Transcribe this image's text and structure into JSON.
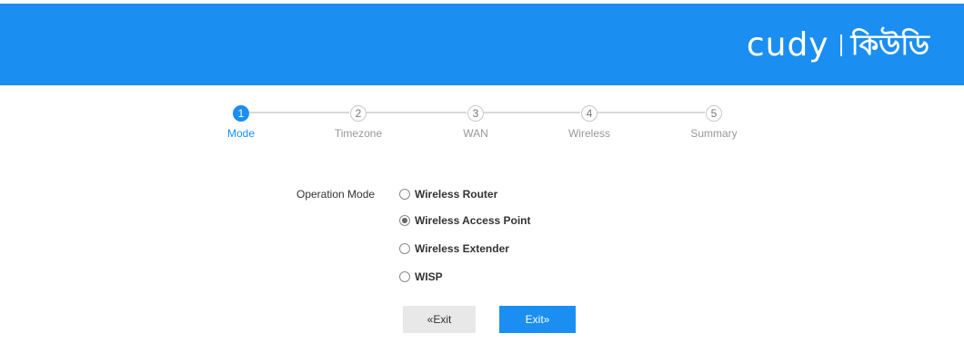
{
  "header": {
    "logo_en": "cudy",
    "logo_bn": "কিউডি",
    "color": "#1b8ef2"
  },
  "stepper": {
    "steps": [
      {
        "number": "1",
        "label": "Mode",
        "active": true
      },
      {
        "number": "2",
        "label": "Timezone",
        "active": false
      },
      {
        "number": "3",
        "label": "WAN",
        "active": false
      },
      {
        "number": "4",
        "label": "Wireless",
        "active": false
      },
      {
        "number": "5",
        "label": "Summary",
        "active": false
      }
    ]
  },
  "form": {
    "label": "Operation Mode",
    "options": [
      {
        "label": "Wireless Router",
        "checked": false
      },
      {
        "label": "Wireless Access Point",
        "checked": true
      },
      {
        "label": "Wireless Extender",
        "checked": false
      },
      {
        "label": "WISP",
        "checked": false
      }
    ]
  },
  "buttons": {
    "prev_label": "«Exit",
    "next_label": "Exit»"
  }
}
